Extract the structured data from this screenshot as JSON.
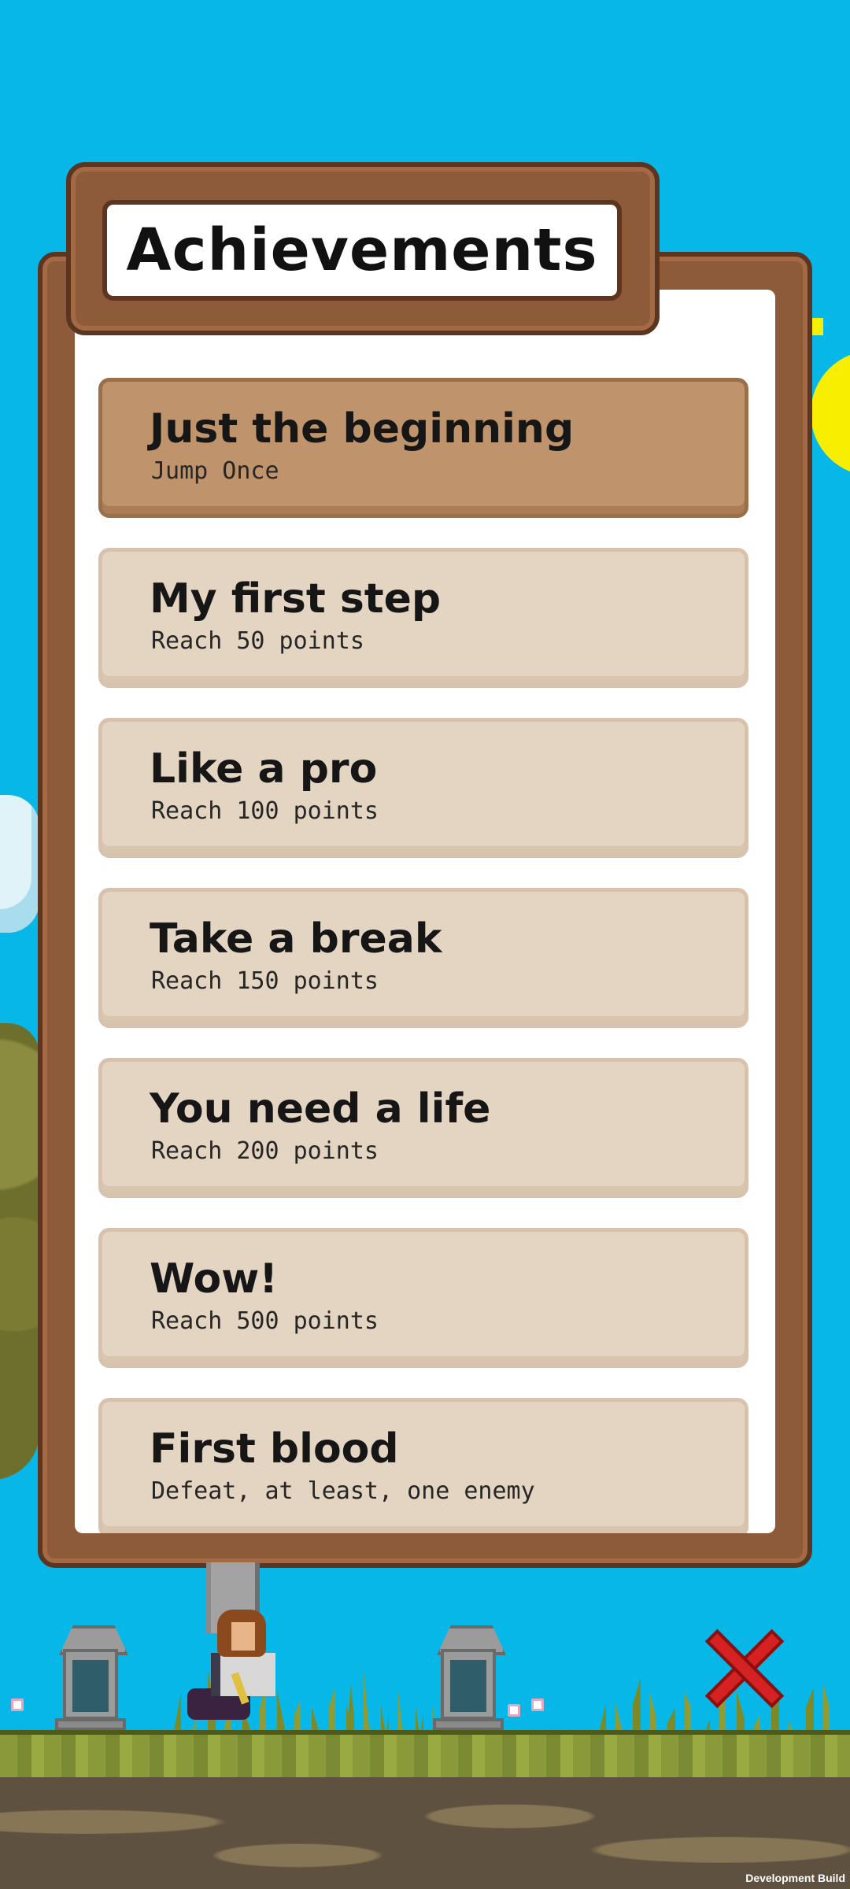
{
  "header": {
    "title": "Achievements"
  },
  "achievements": [
    {
      "title": "Just the beginning",
      "description": "Jump Once",
      "selected": true
    },
    {
      "title": "My first step",
      "description": "Reach 50 points",
      "selected": false
    },
    {
      "title": "Like a pro",
      "description": "Reach 100 points",
      "selected": false
    },
    {
      "title": "Take a break",
      "description": "Reach 150 points",
      "selected": false
    },
    {
      "title": "You need a life",
      "description": "Reach 200 points",
      "selected": false
    },
    {
      "title": "Wow!",
      "description": "Reach 500 points",
      "selected": false
    },
    {
      "title": "First blood",
      "description": "Defeat, at least, one enemy",
      "selected": false
    }
  ],
  "close_button": {
    "icon": "close-x-icon"
  },
  "footer": {
    "build_label": "Development Build"
  },
  "colors": {
    "sky": "#06b7e7",
    "panel_brown": "#8d5a3a",
    "item_selected": "#bf946c",
    "item_default": "#e4d5c3",
    "close_red": "#d42121"
  }
}
